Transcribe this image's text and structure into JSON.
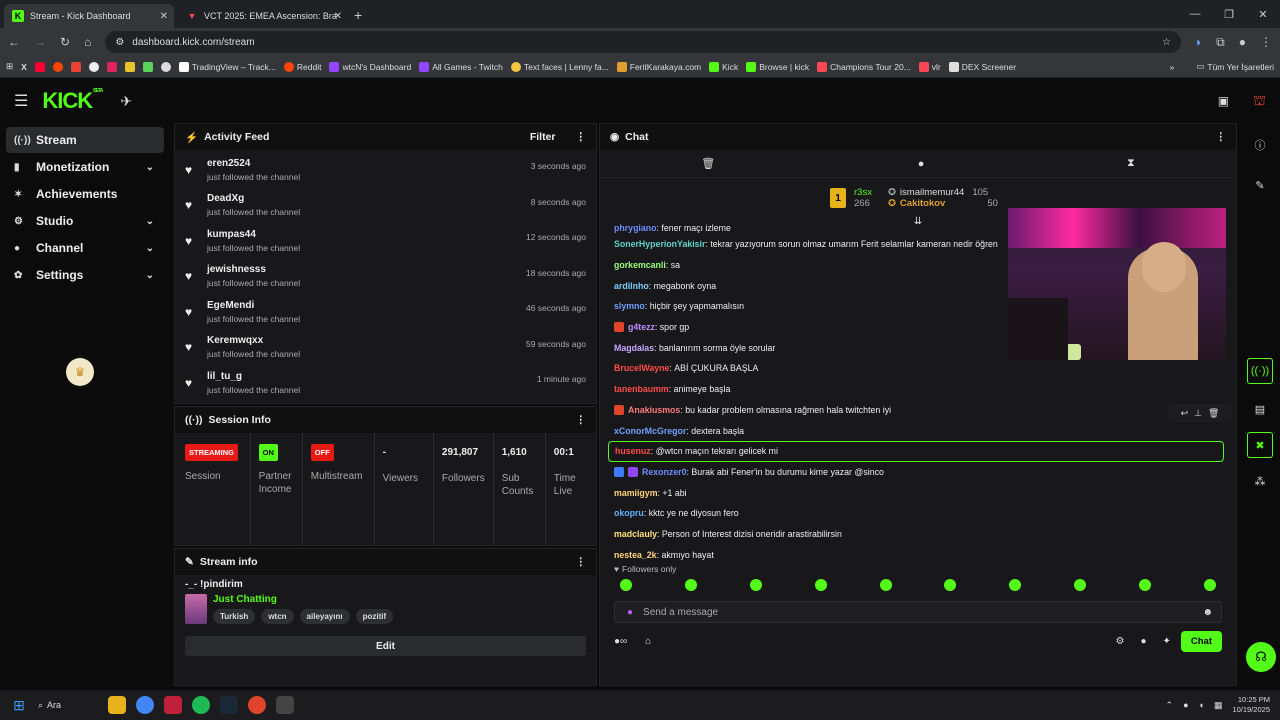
{
  "browser": {
    "tabs": [
      {
        "title": "Stream - Kick Dashboard",
        "active": true
      },
      {
        "title": "VCT 2025: EMEA Ascension: Bra",
        "active": false
      }
    ],
    "url": "dashboard.kick.com/stream",
    "bookmarks": [
      "TradingView – Track...",
      "Reddit",
      "wtcN's Dashboard",
      "All Games - Twitch",
      "Text faces | Lenny fa...",
      "FeritKarakaya.com",
      "Kick",
      "Browse | kick",
      "Champions Tour 20...",
      "vlr",
      "DEX Screener"
    ],
    "bookmarks_other": "Tüm Yer İşaretleri"
  },
  "app": {
    "logo": "KICK",
    "logo_tag": "BETA"
  },
  "nav": {
    "items": [
      {
        "label": "Stream",
        "icon": "broadcast-icon",
        "selected": true,
        "expand": false
      },
      {
        "label": "Monetization",
        "icon": "dollar-icon",
        "selected": false,
        "expand": true
      },
      {
        "label": "Achievements",
        "icon": "star-icon",
        "selected": false,
        "expand": false
      },
      {
        "label": "Studio",
        "icon": "studio-icon",
        "selected": false,
        "expand": true
      },
      {
        "label": "Channel",
        "icon": "user-icon",
        "selected": false,
        "expand": true
      },
      {
        "label": "Settings",
        "icon": "gear-icon",
        "selected": false,
        "expand": true
      }
    ]
  },
  "activity": {
    "title": "Activity Feed",
    "filter": "Filter",
    "items": [
      {
        "user": "eren2524",
        "action": "just followed the channel",
        "time": "3 seconds ago"
      },
      {
        "user": "DeadXg",
        "action": "just followed the channel",
        "time": "8 seconds ago"
      },
      {
        "user": "kumpas44",
        "action": "just followed the channel",
        "time": "12 seconds ago"
      },
      {
        "user": "jewishnesss",
        "action": "just followed the channel",
        "time": "18 seconds ago"
      },
      {
        "user": "EgeMendi",
        "action": "just followed the channel",
        "time": "46 seconds ago"
      },
      {
        "user": "Keremwqxx",
        "action": "just followed the channel",
        "time": "59 seconds ago"
      },
      {
        "user": "lil_tu_g",
        "action": "just followed the channel",
        "time": "1 minute ago"
      }
    ]
  },
  "session": {
    "title": "Session Info",
    "cols": [
      {
        "badge": "STREAMING",
        "badge_color": "#e91916",
        "label": "Session"
      },
      {
        "badge": "ON",
        "badge_color": "#53fc18",
        "label": "Partner Income"
      },
      {
        "badge": "OFF",
        "badge_color": "#e91916",
        "label": "Multistream"
      },
      {
        "value": "-",
        "label": "Viewers"
      },
      {
        "value": "291,807",
        "label": "Followers"
      },
      {
        "value": "1,610",
        "label": "Sub Counts"
      },
      {
        "value": "00:1",
        "label": "Time Live"
      }
    ]
  },
  "stream_info": {
    "title": "Stream info",
    "stream_title": "-_- !pindirim",
    "category": "Just Chatting",
    "tags": [
      "Turkish",
      "wtcn",
      "aileyayını",
      "pozitif"
    ],
    "edit": "Edit"
  },
  "chat": {
    "title": "Chat",
    "leaderboard": [
      {
        "name": "r3sx",
        "value": "266"
      },
      {
        "name": "ismailmemur44",
        "value": "105"
      },
      {
        "name": "Cakitokov",
        "value": "50"
      }
    ],
    "messages": [
      {
        "user": "phrygiano",
        "color": "#6f8bff",
        "text": "fener maçı izleme"
      },
      {
        "user": "SonerHyperionYakisir",
        "color": "#5fd3c8",
        "text": "tekrar yazıyorum sorun olmaz umarım Ferit selamlar kameran nedir öğren"
      },
      {
        "user": "gorkemcanli",
        "color": "#9bff7a",
        "text": "sa"
      },
      {
        "user": "ardilnho",
        "color": "#7ad0ff",
        "text": "megabonk oyna"
      },
      {
        "user": "slymno",
        "color": "#6fa0ff",
        "text": "hiçbir şey yapmamalısın"
      },
      {
        "user": "g4tezz",
        "color": "#c08aff",
        "text": "spor gp"
      },
      {
        "user": "Magdalas",
        "color": "#c7a6ff",
        "text": "banlanırım sorma öyle sorular"
      },
      {
        "user": "BruceIWayne",
        "color": "#ff4b4b",
        "text": "ABİ ÇUKURA BAŞLA"
      },
      {
        "user": "tanenbaumm",
        "color": "#ff4b4b",
        "text": "animeye başla"
      },
      {
        "user": "Anakiusmos",
        "color": "#ff7a7a",
        "text": "bu kadar problem olmasına rağmen hala twitchten iyi"
      },
      {
        "user": "xConorMcGregor",
        "color": "#6fa0ff",
        "text": "dextera başla"
      },
      {
        "user": "husenuz",
        "color": "#ff4b4b",
        "text": "@wtcn maçın tekrarı gelicek mi"
      },
      {
        "user": "Rexonzer0",
        "color": "#6f8bff",
        "text": "Burak abi Fener'in bu durumu kime yazar @sinco"
      },
      {
        "user": "mamiigym",
        "color": "#ffd37a",
        "text": "+1 abi"
      },
      {
        "user": "okopru",
        "color": "#5fb0ff",
        "text": "kktc ye ne diyosun fero"
      },
      {
        "user": "madclauly",
        "color": "#ffe07a",
        "text": "Person of Interest dizisi oneridir arastirabilirsin"
      },
      {
        "user": "nestea_2k",
        "color": "#ffd37a",
        "text": "akmıyo hayat"
      }
    ],
    "followers_only": "Followers only",
    "placeholder": "Send a message",
    "send": "Chat"
  },
  "taskbar": {
    "search": "Ara",
    "time": "10:25 PM",
    "date": "10/19/2025"
  }
}
